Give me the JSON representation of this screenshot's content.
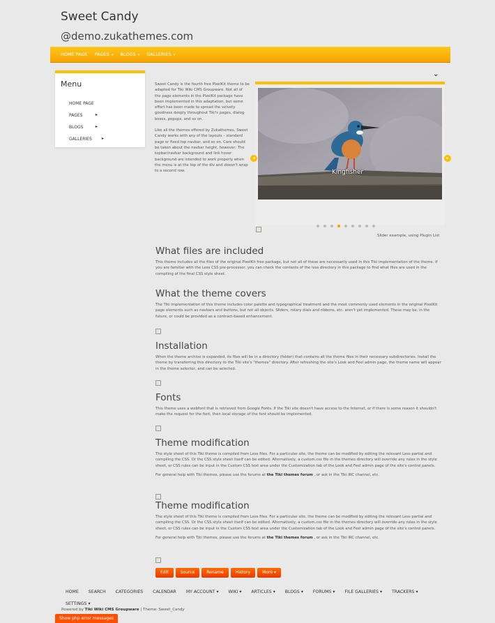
{
  "site": {
    "title": "Sweet Candy",
    "subtitle": "@demo.zukathemes.com"
  },
  "navbar": {
    "items": [
      {
        "label": "HOME PAGE",
        "caret": ""
      },
      {
        "label": "PAGES",
        "caret": "▾"
      },
      {
        "label": "BLOGS",
        "caret": "▾"
      },
      {
        "label": "GALLERIES",
        "caret": "▾"
      }
    ]
  },
  "menu": {
    "title": "Menu",
    "items": [
      {
        "label": "HOME PAGE",
        "arrow": ""
      },
      {
        "label": "PAGES",
        "arrow": "▸"
      },
      {
        "label": "BLOGS",
        "arrow": "▸"
      },
      {
        "label": "GALLERIES",
        "arrow": "▸"
      }
    ]
  },
  "intro": {
    "p1": "Sweet Candy is the fourth free PixelKit theme to be adapted for Tiki Wiki CMS Groupware. Not all of the page elements in the PixelKit package have been implemented in this adaptation, but some effort has been made to spread the velvety goodness deeply throughout Tiki's pages, dialog boxes, popups, and so on.",
    "p2": "Like all the themes offered by Zukathemes, Sweet Candy works with any of the layouts – standard page or fixed top navbar, and so on. Care should be taken about the navbar height, however: The topbar/navbar background and link hover background are intended to work properly when the menu is at the top of the div and doesn't wrap to a second row."
  },
  "slider": {
    "caption": "Kingfisher",
    "note": "Slider example, using Plugin List",
    "dot_count": 9,
    "active_dot": 3,
    "prev_icon": "◂",
    "next_icon": "▸"
  },
  "collapse_icon": "⌄",
  "sections": [
    {
      "heading": "What files are included",
      "body": "This theme includes all the files of the original PixelKit free package, but not all of these are necessarily used in this Tiki implementation of the theme. If you are familiar with the Less CSS pre-processor, you can check the contents of the less directory in this package to find what files are used in the compiling of the final CSS style sheet."
    },
    {
      "heading": "What the theme covers",
      "body": "The Tiki implementation of this theme includes color palette and typographical treatment and the most commonly used elements in the original PixelKit page elements such as navbars and buttons, but not all objects. Sliders, rotary dials and ribbons, etc. aren't yet implemented. These may be, in the future, or could be provided as a contract-based enhancement."
    },
    {
      "heading": "Installation",
      "body": "When the theme archive is expanded, its files will be in a directory (folder) that contains all the theme files in their necessary subdirectories. Install the theme by transferring this directory to the Tiki site's \"themes\" directory. After refreshing the site's Look and Feel admin page, the theme name will appear in the theme selector, and can be selected."
    },
    {
      "heading": "Fonts",
      "body": "This theme uses a webfont that is retrieved from Google Fonts. If the Tiki site doesn't have access to the Internet, or if there is some reason it shouldn't make the request for the font, then local storage of the font should be implemented."
    },
    {
      "heading": "Theme modification",
      "body": "The style sheet of this Tiki theme is compiled from Less files. For a particular site, the theme can be modified by editing the relevant Less partial and compiling the CSS. Or the CSS style sheet itself can be edited. Alternatively, a custom.css file in the themes directory will override any rules in the style sheet, or CSS rules can be input in the Custom CSS text area under the Customization tab of the Look and Feel admin page of the site's control panels.",
      "help_pre": "For general help with Tiki themes, please use the forums at",
      "help_link": "the Tiki themes forum",
      "help_post": ", or ask in the Tiki IRC channel, etc."
    },
    {
      "heading": "Theme modification",
      "body": "The style sheet of this Tiki theme is compiled from Less files. For a particular site, the theme can be modified by editing the relevant Less partial and compiling the CSS. Or the CSS style sheet itself can be edited. Alternatively, a custom.css file in the themes directory will override any rules in the style sheet, or CSS rules can be input in the Custom CSS text area under the Customization tab of the Look and Feel admin page of the site's control panels.",
      "help_pre": "For general help with Tiki themes, please use the forums at",
      "help_link": "the Tiki themes forum",
      "help_post": ", or ask in the Tiki IRC channel, etc."
    }
  ],
  "actions": {
    "edit": "Edit",
    "source": "Source",
    "rename": "Rename",
    "history": "History",
    "more": "More ▾"
  },
  "footer_nav": [
    {
      "label": "HOME",
      "caret": ""
    },
    {
      "label": "SEARCH",
      "caret": ""
    },
    {
      "label": "CATEGORIES",
      "caret": ""
    },
    {
      "label": "CALENDAR",
      "caret": ""
    },
    {
      "label": "MY ACCOUNT",
      "caret": "▾"
    },
    {
      "label": "WIKI",
      "caret": "▾"
    },
    {
      "label": "ARTICLES",
      "caret": "▾"
    },
    {
      "label": "BLOGS",
      "caret": "▾"
    },
    {
      "label": "FORUMS",
      "caret": "▾"
    },
    {
      "label": "FILE GALLERIES",
      "caret": "▾"
    },
    {
      "label": "TRACKERS",
      "caret": "▾"
    },
    {
      "label": "SETTINGS",
      "caret": "▾"
    }
  ],
  "footer": {
    "powered_pre": "Powered by",
    "powered_link": "Tiki Wiki CMS Groupware",
    "theme_text": "| Theme: Sweet_Candy"
  },
  "error_button": "Show php error messages",
  "colors": {
    "accent": "#ffbf00",
    "accent_dark": "#f5a300",
    "button": "#ff5a00"
  }
}
